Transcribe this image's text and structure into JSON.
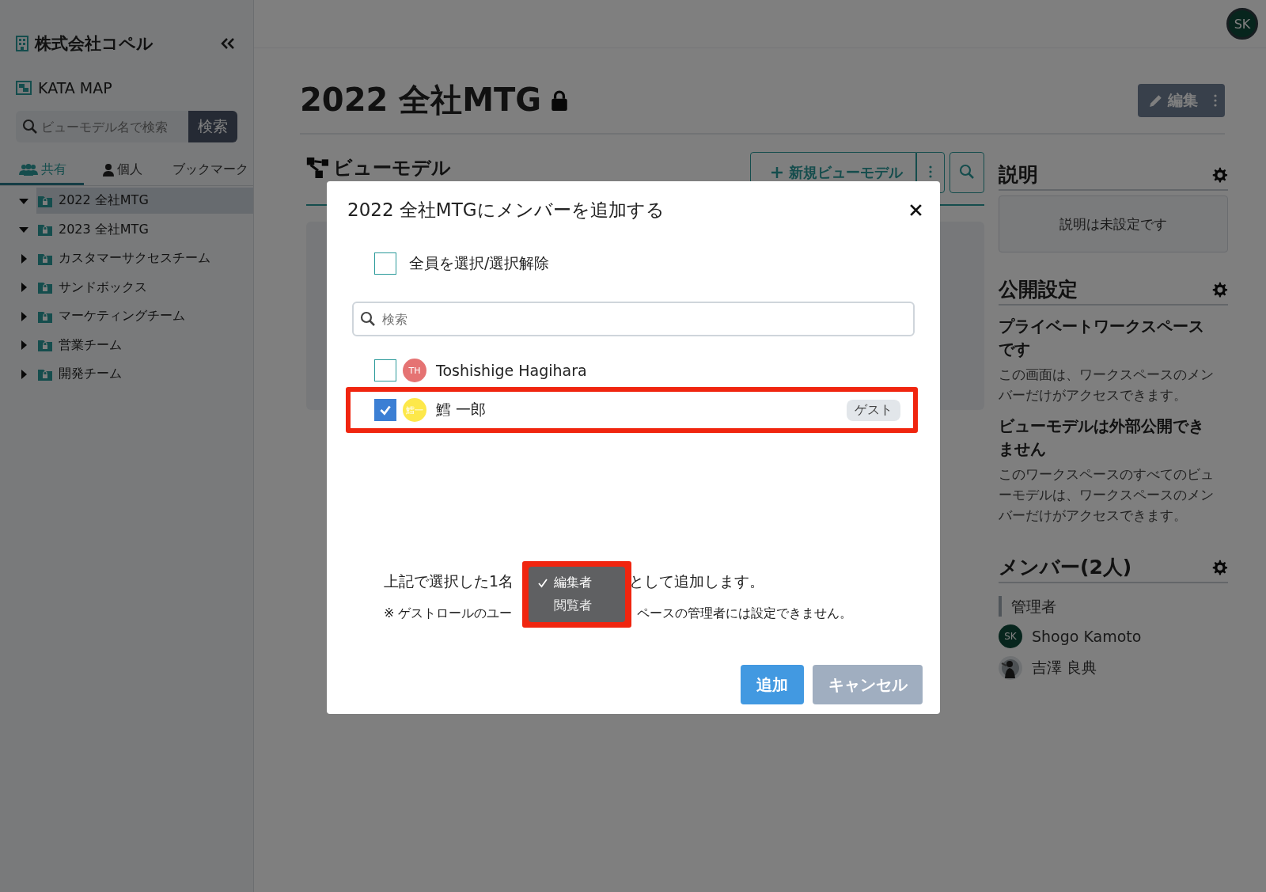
{
  "sidebar": {
    "org_name": "株式会社コペル",
    "app_name": "KATA MAP",
    "search": {
      "placeholder": "ビューモデル名で検索",
      "button": "検索"
    },
    "tabs": [
      {
        "label": "共有",
        "kind": "group",
        "selected": true
      },
      {
        "label": "個人",
        "kind": "person",
        "selected": false
      },
      {
        "label": "ブックマーク",
        "kind": "plain",
        "selected": false
      }
    ],
    "tree": [
      {
        "label": "2022 全社MTG",
        "expanded": true,
        "selected": true
      },
      {
        "label": "2023 全社MTG",
        "expanded": true,
        "selected": false
      },
      {
        "label": "カスタマーサクセスチーム",
        "expanded": false,
        "selected": false
      },
      {
        "label": "サンドボックス",
        "expanded": false,
        "selected": false
      },
      {
        "label": "マーケティングチーム",
        "expanded": false,
        "selected": false
      },
      {
        "label": "営業チーム",
        "expanded": false,
        "selected": false
      },
      {
        "label": "開発チーム",
        "expanded": false,
        "selected": false
      }
    ]
  },
  "header": {
    "avatar": "SK"
  },
  "page": {
    "title": "2022 全社MTG",
    "locked": true,
    "edit_button": "編集"
  },
  "viewmodels": {
    "heading": "ビューモデル",
    "new_button": "新規ビューモデル"
  },
  "right_panel": {
    "description": {
      "heading": "説明",
      "empty_text": "説明は未設定です"
    },
    "visibility": {
      "heading": "公開設定",
      "items": [
        {
          "title": "プライベートワークスペースです",
          "text": "この画面は、ワークスペースのメンバーだけがアクセスできます。"
        },
        {
          "title": "ビューモデルは外部公開できません",
          "text": "このワークスペースのすべてのビューモデルは、ワークスペースのメンバーだけがアクセスできます。"
        }
      ]
    },
    "members": {
      "heading": "メンバー(2人)",
      "group": "管理者",
      "people": [
        {
          "name": "Shogo Kamoto",
          "kind": "initials",
          "initials": "SK"
        },
        {
          "name": "吉澤 良典",
          "kind": "picture"
        }
      ]
    }
  },
  "dialog": {
    "title": "2022 全社MTGにメンバーを追加する",
    "select_all": {
      "label": "全員を選択/選択解除",
      "checked": false
    },
    "search": {
      "placeholder": "検索"
    },
    "members": [
      {
        "name": "Toshishige Hagihara",
        "initials": "TH",
        "color": "#e57373",
        "checked": false,
        "highlighted": false
      },
      {
        "name": "鱈 一郎",
        "initials": "鱈一",
        "color": "#fde84a",
        "checked": true,
        "badge": "ゲスト",
        "highlighted": true
      }
    ],
    "sentence_start": "上記で選択した1名",
    "sentence_end": "として追加します。",
    "note_start": "※ ゲストロールのユー",
    "note_end": "ペースの管理者には設定できません。",
    "role_menu": {
      "highlighted": true,
      "options": [
        {
          "label": "編集者",
          "selected": true
        },
        {
          "label": "閲覧者",
          "selected": false
        }
      ]
    },
    "buttons": {
      "add": "追加",
      "cancel": "キャンセル"
    }
  }
}
